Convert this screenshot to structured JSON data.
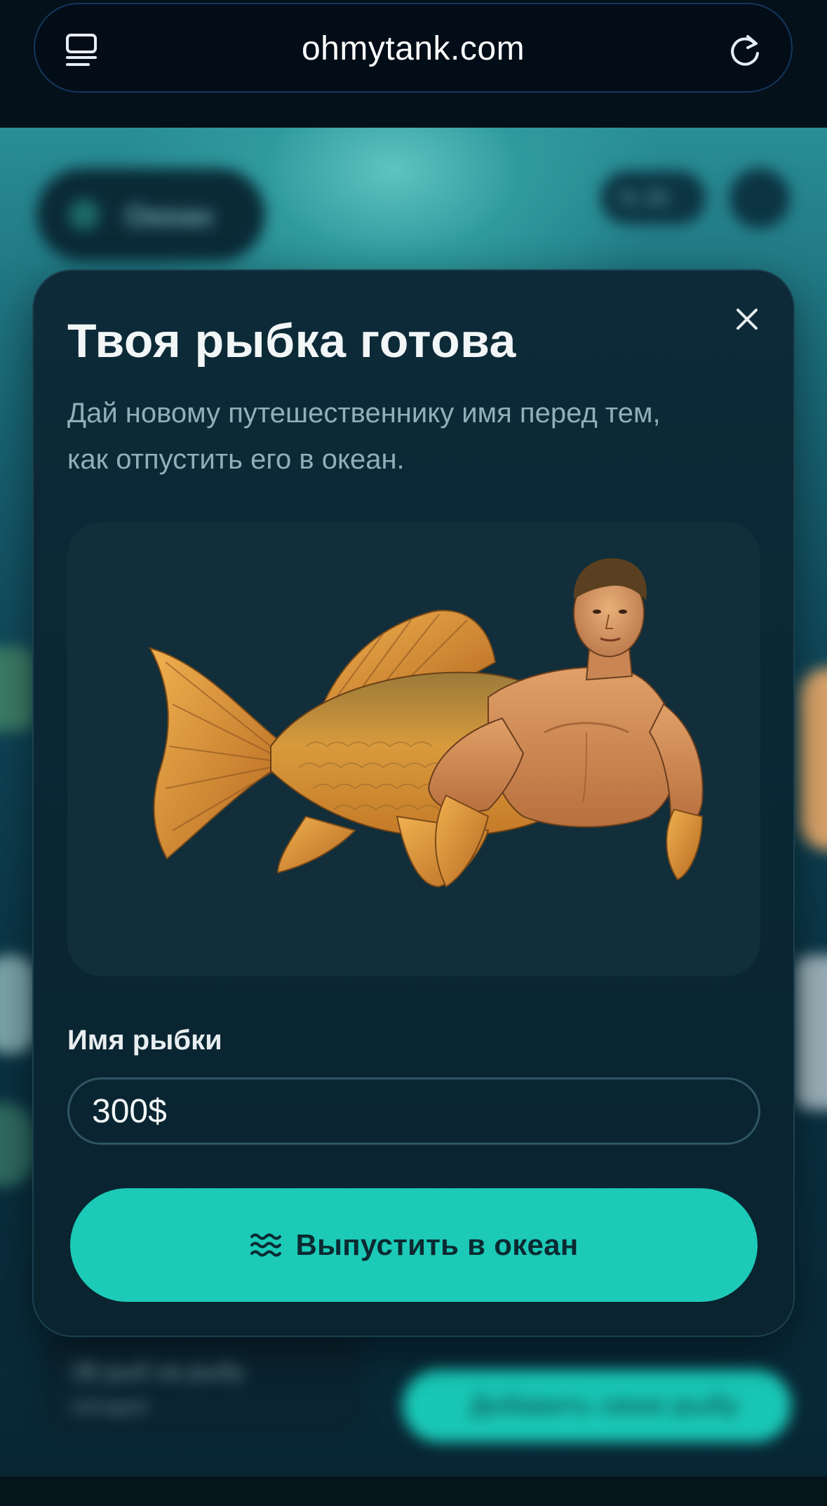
{
  "browser": {
    "url": "ohmytank.com"
  },
  "background_app": {
    "ocean_chip_label": "Океан",
    "time_chip_label": "% 3h",
    "counter_line1": "38 рыб на рыбу",
    "counter_line2": "сегодня",
    "add_fish_label": "Добавить свою рыбу"
  },
  "modal": {
    "title": "Твоя рыбка готова",
    "subtitle": "Дай новому путешественнику имя перед тем, как отпустить его в океан.",
    "image_alt": "Рыба с мускулистым человеческим торсом",
    "name_label": "Имя рыбки",
    "name_value": "300$",
    "release_button": "Выпустить в океан",
    "release_icon": "waves-icon",
    "close_icon": "close-icon"
  },
  "colors": {
    "accent": "#1ccab7",
    "modal_bg": "#0b2734",
    "card_bg": "#112e3a"
  }
}
